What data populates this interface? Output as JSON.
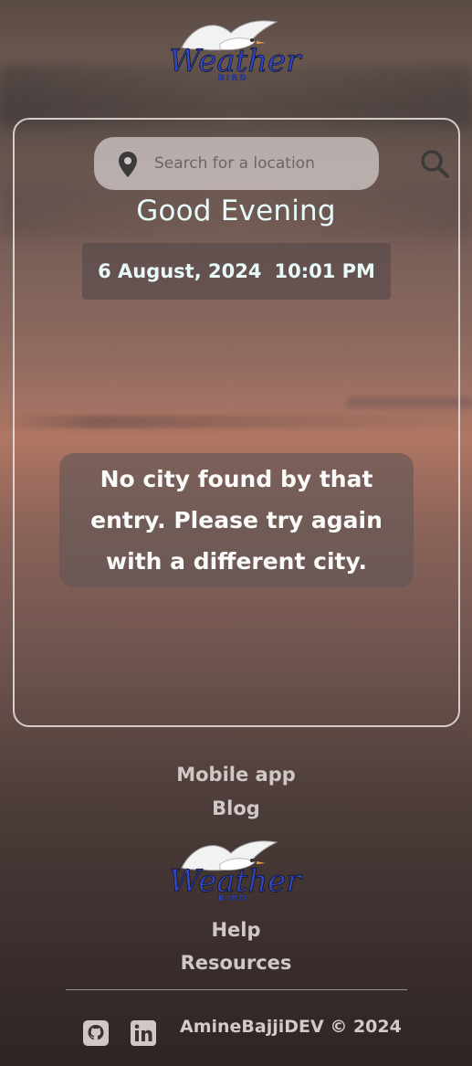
{
  "brand": {
    "logo_word": "Weather",
    "logo_sub": "BIRD"
  },
  "search": {
    "placeholder": "Search for a location"
  },
  "greeting": "Good Evening",
  "datetime": {
    "date": "6 August, 2024",
    "time": "10:01 PM"
  },
  "message": "No city found by that entry. Please try again with a different city.",
  "footer": {
    "links_top": [
      "Mobile app",
      "Blog"
    ],
    "links_bottom": [
      "Help",
      "Resources"
    ],
    "copyright": "AmineBajjiDEV © 2024"
  },
  "icons": {
    "location": "location-pin-icon",
    "search": "search-icon",
    "github": "github-icon",
    "linkedin": "linkedin-icon"
  },
  "colors": {
    "text_accent": "#e6fbfa",
    "logo_blue": "#2f46c9"
  }
}
